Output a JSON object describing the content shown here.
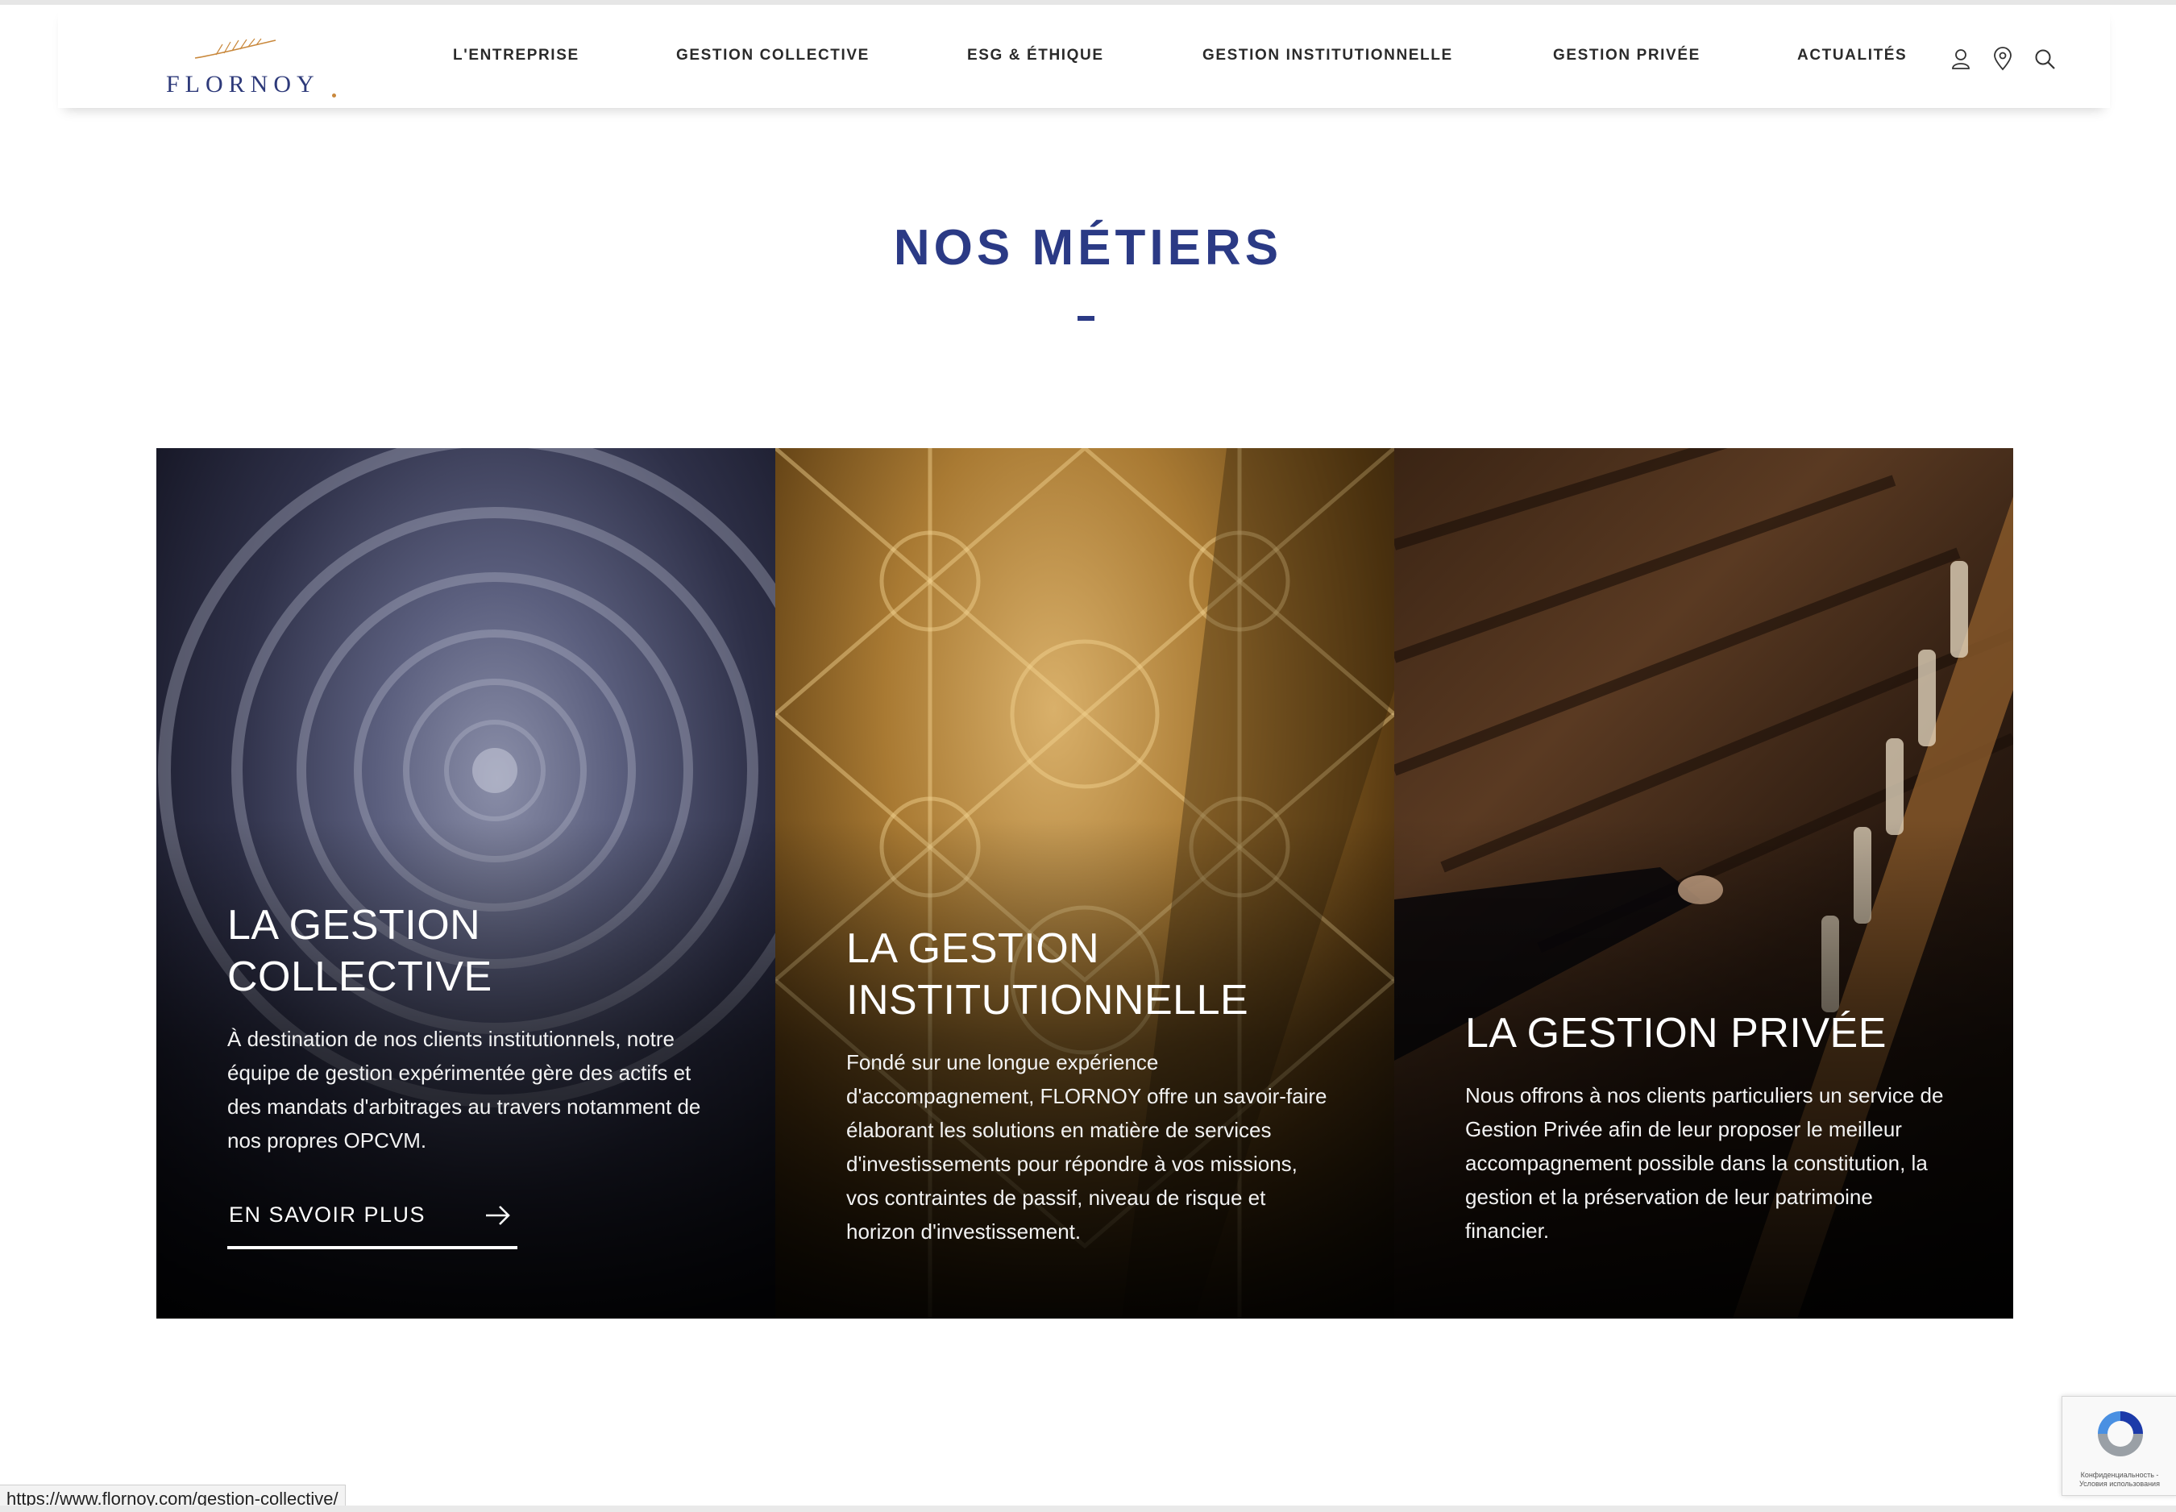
{
  "header": {
    "logo_text": "FLORNOY",
    "nav": [
      "L'ENTREPRISE",
      "GESTION COLLECTIVE",
      "ESG & ÉTHIQUE",
      "GESTION INSTITUTIONNELLE",
      "GESTION PRIVÉE",
      "ACTUALITÉS"
    ],
    "icons": [
      "user-icon",
      "location-pin-icon",
      "search-icon"
    ]
  },
  "main": {
    "title": "NOS MÉTIERS",
    "cards": [
      {
        "title_line1": "LA GESTION",
        "title_line2": "COLLECTIVE",
        "text": "À destination de nos clients institutionnels, notre équipe de gestion expérimentée gère des actifs et des mandats d'arbitrages au travers notamment de nos propres OPCVM.",
        "link_label": "EN SAVOIR PLUS"
      },
      {
        "title_line1": "LA GESTION",
        "title_line2": "INSTITUTIONNELLE",
        "text": "Fondé sur une longue expérience d'accompagnement, FLORNOY offre un savoir-faire élaborant les solutions en matière de services d'investissements pour répondre à vos missions, vos contraintes de passif, niveau de risque et horizon d'investissement."
      },
      {
        "title_line1": "LA GESTION PRIVÉE",
        "text": "Nous offrons à nos clients particuliers un service de Gestion Privée afin de leur proposer le meilleur accompagnement possible dans la constitution, la gestion et la préservation de leur patrimoine financier."
      }
    ]
  },
  "status_bar": {
    "url": "https://www.flornoy.com/gestion-collective/"
  },
  "recaptcha": {
    "text_line1": "Конфиденциальность -",
    "text_line2": "Условия использования"
  },
  "colors": {
    "brand_blue": "#2b3a85",
    "logo_gold": "#c9883c"
  }
}
